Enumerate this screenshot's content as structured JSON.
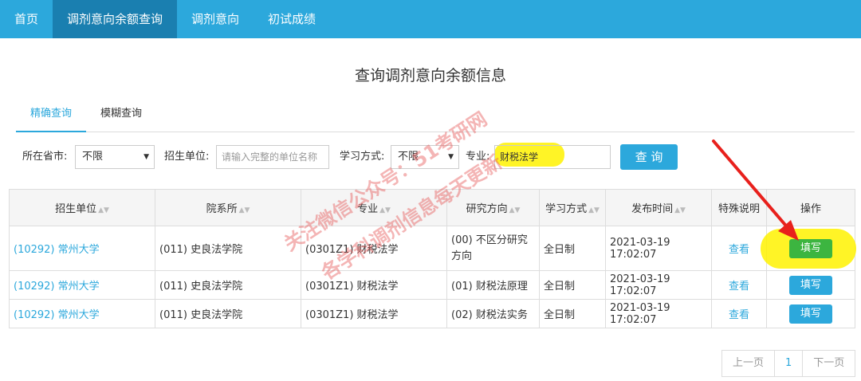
{
  "nav": {
    "items": [
      {
        "label": "首页",
        "active": false
      },
      {
        "label": "调剂意向余额查询",
        "active": true
      },
      {
        "label": "调剂意向",
        "active": false
      },
      {
        "label": "初试成绩",
        "active": false
      }
    ]
  },
  "page_title": "查询调剂意向余额信息",
  "tabs": [
    {
      "label": "精确查询",
      "active": true
    },
    {
      "label": "模糊查询",
      "active": false
    }
  ],
  "filters": {
    "province_label": "所在省市:",
    "province_value": "不限",
    "unit_label": "招生单位:",
    "unit_placeholder": "请输入完整的单位名称",
    "mode_label": "学习方式:",
    "mode_value": "不限",
    "major_label": "专业:",
    "major_value": "财税法学",
    "query_button": "查 询"
  },
  "table": {
    "headers": [
      "招生单位",
      "院系所",
      "专业",
      "研究方向",
      "学习方式",
      "发布时间",
      "特殊说明",
      "操作"
    ],
    "rows": [
      {
        "unit": "(10292) 常州大学",
        "dept": "(011) 史良法学院",
        "major": "(0301Z1) 财税法学",
        "direction": "(00) 不区分研究方向",
        "mode": "全日制",
        "time": "2021-03-19 17:02:07",
        "note": "查看",
        "action": "填写"
      },
      {
        "unit": "(10292) 常州大学",
        "dept": "(011) 史良法学院",
        "major": "(0301Z1) 财税法学",
        "direction": "(01) 财税法原理",
        "mode": "全日制",
        "time": "2021-03-19 17:02:07",
        "note": "查看",
        "action": "填写"
      },
      {
        "unit": "(10292) 常州大学",
        "dept": "(011) 史良法学院",
        "major": "(0301Z1) 财税法学",
        "direction": "(02) 财税法实务",
        "mode": "全日制",
        "time": "2021-03-19 17:02:07",
        "note": "查看",
        "action": "填写"
      }
    ]
  },
  "pager": {
    "prev": "上一页",
    "current": "1",
    "next": "下一页"
  },
  "watermark": {
    "line1": "关注微信公众号：51考研网",
    "line2": "各学科调剂信息每天更新"
  },
  "colors": {
    "brand": "#2ca8dc",
    "highlight": "#fff200",
    "arrow": "#e8201c",
    "fill_active": "#3cb540"
  }
}
